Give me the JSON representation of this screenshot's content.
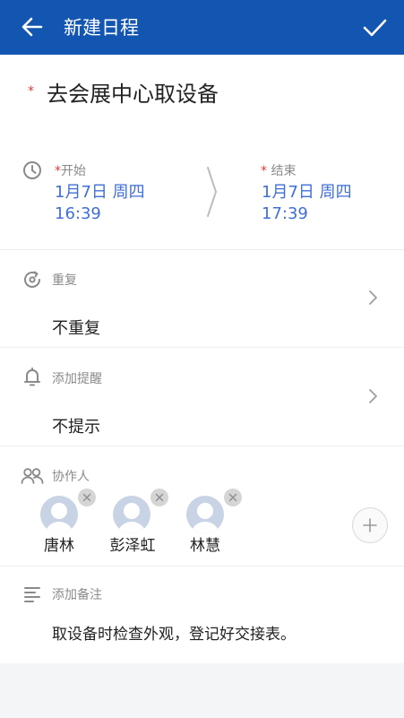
{
  "appbar": {
    "title": "新建日程"
  },
  "event": {
    "required_mark": "*",
    "title": "去会展中心取设备"
  },
  "time": {
    "start": {
      "required_mark": "*",
      "label": "开始",
      "date": "1月7日 周四",
      "time": "16:39"
    },
    "end": {
      "required_mark": "*",
      "label": "结束",
      "date": "1月7日 周四",
      "time": "17:39"
    }
  },
  "repeat": {
    "label": "重复",
    "value": "不重复"
  },
  "reminder": {
    "label": "添加提醒",
    "value": "不提示"
  },
  "collaborators": {
    "label": "协作人",
    "people": [
      {
        "name": "唐林"
      },
      {
        "name": "彭泽虹"
      },
      {
        "name": "林慧"
      }
    ]
  },
  "notes": {
    "label": "添加备注",
    "text": "取设备时检查外观，登记好交接表。"
  },
  "colors": {
    "primary": "#1356b2",
    "accent_text": "#3f6fd6",
    "required": "#e53935"
  },
  "icons": [
    "arrow-left-icon",
    "check-icon",
    "clock-icon",
    "repeat-icon",
    "bell-icon",
    "people-icon",
    "notes-icon",
    "chevron-right-icon",
    "close-icon",
    "plus-icon",
    "avatar-placeholder-icon"
  ]
}
